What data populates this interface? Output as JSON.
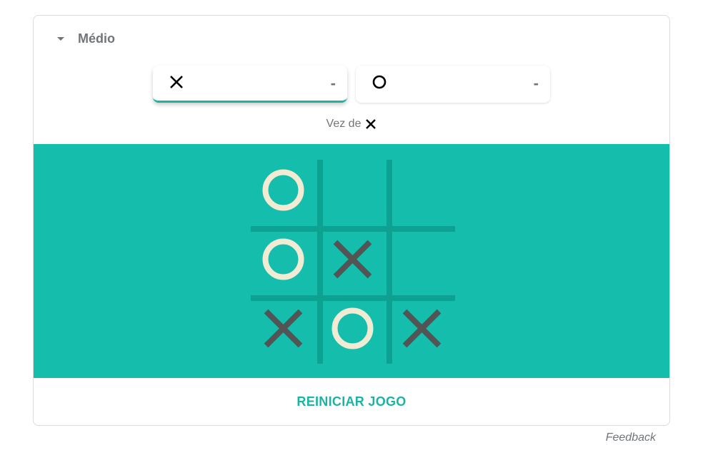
{
  "difficulty": {
    "label": "Médio",
    "icon": "dropdown-triangle-icon"
  },
  "players": [
    {
      "symbol": "X",
      "score": "-",
      "active": true
    },
    {
      "symbol": "O",
      "score": "-",
      "active": false
    }
  ],
  "turn": {
    "label": "Vez de",
    "symbol": "X"
  },
  "board": [
    [
      "O",
      "",
      ""
    ],
    [
      "O",
      "X",
      ""
    ],
    [
      "X",
      "O",
      "X"
    ]
  ],
  "colors": {
    "board_bg": "#14bdac",
    "grid_line": "#0da192",
    "x_mark": "#545454",
    "o_mark": "#f2ebd3",
    "accent": "#1bb3a3"
  },
  "restart_label": "REINICIAR JOGO",
  "feedback_label": "Feedback"
}
